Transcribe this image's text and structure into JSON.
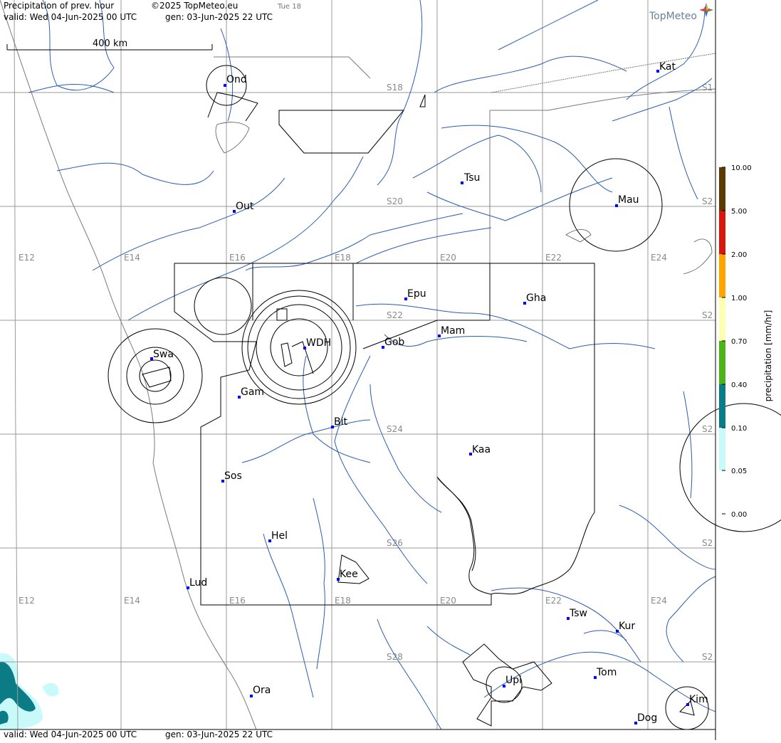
{
  "header": {
    "title": "Precipitation of prev. hour",
    "copyright": "©2025 TopMeteo.eu",
    "tab": "Tue 18",
    "valid": "valid:  Wed  04-Jun-2025  00 UTC",
    "generated": "gen: 03-Jun-2025 22 UTC",
    "brand": "TopMeteo"
  },
  "footer": {
    "valid": "valid:  Wed  04-Jun-2025  00 UTC",
    "generated": "gen: 03-Jun-2025 22 UTC"
  },
  "scale_bar": {
    "label": "400 km"
  },
  "grid_labels": {
    "longitudes": [
      "E12",
      "E14",
      "E16",
      "E18",
      "E20",
      "E22",
      "E24"
    ],
    "latitudes": [
      "S18",
      "S20",
      "S22",
      "S24",
      "S26",
      "S28"
    ],
    "edge": [
      "S1",
      "S2",
      "S2",
      "S2",
      "S2",
      "S2"
    ]
  },
  "stations": [
    {
      "name": "Ond"
    },
    {
      "name": "Kat"
    },
    {
      "name": "Tsu"
    },
    {
      "name": "Out"
    },
    {
      "name": "Mau"
    },
    {
      "name": "Epu"
    },
    {
      "name": "Gha"
    },
    {
      "name": "Mam"
    },
    {
      "name": "Swa"
    },
    {
      "name": "WDH"
    },
    {
      "name": "Gob"
    },
    {
      "name": "Gam"
    },
    {
      "name": "Bit"
    },
    {
      "name": "Kaa"
    },
    {
      "name": "Sos"
    },
    {
      "name": "Hel"
    },
    {
      "name": "Kee"
    },
    {
      "name": "Lud"
    },
    {
      "name": "Tsw"
    },
    {
      "name": "Kur"
    },
    {
      "name": "Tom"
    },
    {
      "name": "Upi"
    },
    {
      "name": "Ora"
    },
    {
      "name": "Kim"
    },
    {
      "name": "Dog"
    }
  ],
  "legend": {
    "title": "precipitation [mm/hr]",
    "levels": [
      {
        "value": "10.00",
        "color": "#5c3a06"
      },
      {
        "value": "5.00",
        "color": "#d6190c"
      },
      {
        "value": "2.00",
        "color": "#ffa500"
      },
      {
        "value": "1.00",
        "color": "#ffffb4"
      },
      {
        "value": "0.70",
        "color": "#4db31a"
      },
      {
        "value": "0.40",
        "color": "#0b7b86"
      },
      {
        "value": "0.10",
        "color": "#c8fafa"
      },
      {
        "value": "0.05",
        "color": "#ffffff"
      },
      {
        "value": "0.00",
        "color": "#ffffff"
      }
    ]
  },
  "colors": {
    "river": "#2a5db0",
    "grid": "#9a9a9a",
    "station_dot": "#0000ff",
    "rain_light": "#c8fafa",
    "rain_medium": "#0b7b86"
  }
}
